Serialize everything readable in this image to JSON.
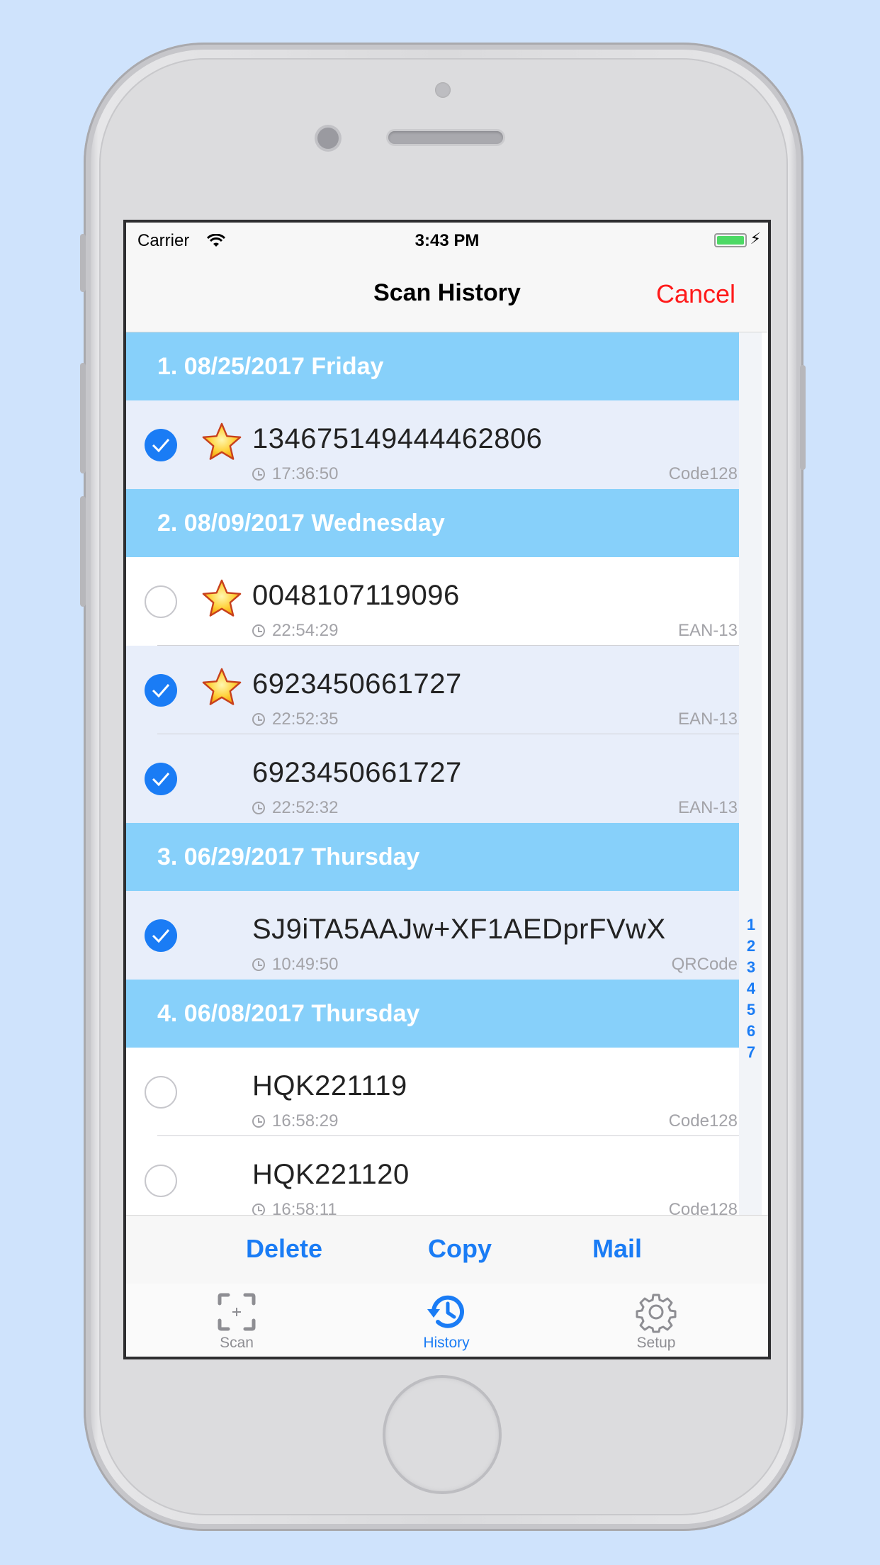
{
  "status": {
    "carrier": "Carrier",
    "time": "3:43 PM"
  },
  "nav": {
    "title": "Scan History",
    "cancel": "Cancel"
  },
  "sections": [
    {
      "label": "1. 08/25/2017  Friday"
    },
    {
      "label": "2. 08/09/2017  Wednesday"
    },
    {
      "label": "3. 06/29/2017  Thursday"
    },
    {
      "label": "4. 06/08/2017  Thursday"
    }
  ],
  "rows": [
    {
      "code": "134675149444462806",
      "time": "17:36:50",
      "type": "Code128",
      "selected": true,
      "starred": true
    },
    {
      "code": "0048107119096",
      "time": "22:54:29",
      "type": "EAN-13",
      "selected": false,
      "starred": true
    },
    {
      "code": "6923450661727",
      "time": "22:52:35",
      "type": "EAN-13",
      "selected": true,
      "starred": true
    },
    {
      "code": "6923450661727",
      "time": "22:52:32",
      "type": "EAN-13",
      "selected": true,
      "starred": false
    },
    {
      "code": "SJ9iTA5AAJw+XF1AEDprFVwX",
      "time": "10:49:50",
      "type": "QRCode",
      "selected": true,
      "starred": false
    },
    {
      "code": "HQK221119",
      "time": "16:58:29",
      "type": "Code128",
      "selected": false,
      "starred": false
    },
    {
      "code": "HQK221120",
      "time": "16:58:11",
      "type": "Code128",
      "selected": false,
      "starred": false
    }
  ],
  "index": [
    "1",
    "2",
    "3",
    "4",
    "5",
    "6",
    "7"
  ],
  "actions": {
    "delete": "Delete",
    "copy": "Copy",
    "mail": "Mail"
  },
  "tabs": {
    "scan": "Scan",
    "history": "History",
    "setup": "Setup"
  },
  "colors": {
    "accent": "#1a7cf5",
    "cancel": "#ff1a1a",
    "section": "#87d0fa",
    "background": "#cfe3fc"
  },
  "icons": {
    "star": "star-icon",
    "clock": "clock-icon",
    "scan": "scan-frame-icon",
    "history": "history-icon",
    "setup": "gear-icon"
  }
}
